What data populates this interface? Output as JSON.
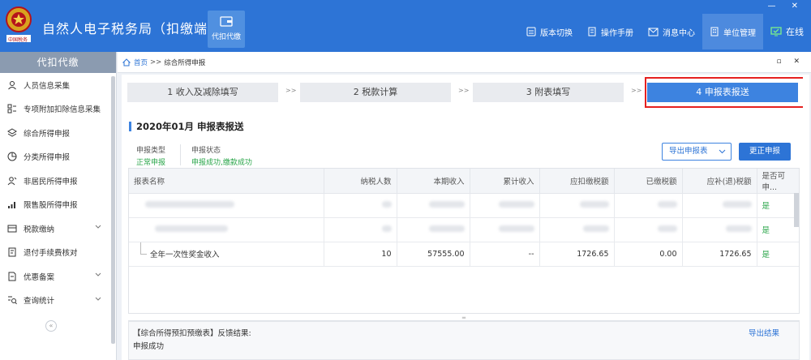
{
  "app": {
    "logo_text": "中国税务",
    "title": "自然人电子税务局（扣缴端）",
    "module_label": "代扣代缴",
    "window_controls": "— ✕"
  },
  "nav": [
    {
      "label": "版本切换",
      "icon": "switch-icon"
    },
    {
      "label": "操作手册",
      "icon": "manual-icon"
    },
    {
      "label": "消息中心",
      "icon": "message-icon"
    },
    {
      "label": "单位管理",
      "icon": "unit-icon"
    },
    {
      "label": "在线",
      "icon": "online-icon"
    }
  ],
  "sidebar": {
    "header": "代扣代缴",
    "items": [
      {
        "label": "人员信息采集",
        "icon": "person-icon",
        "expandable": false
      },
      {
        "label": "专项附加扣除信息采集",
        "icon": "grid-icon",
        "expandable": false
      },
      {
        "label": "综合所得申报",
        "icon": "layers-icon",
        "expandable": false
      },
      {
        "label": "分类所得申报",
        "icon": "pie-icon",
        "expandable": false
      },
      {
        "label": "非居民所得申报",
        "icon": "user-icon",
        "expandable": false
      },
      {
        "label": "限售股所得申报",
        "icon": "bars-icon",
        "expandable": false
      },
      {
        "label": "税款缴纳",
        "icon": "wallet-icon",
        "expandable": true
      },
      {
        "label": "退付手续费核对",
        "icon": "doc-icon",
        "expandable": false
      },
      {
        "label": "优惠备案",
        "icon": "file-icon",
        "expandable": true
      },
      {
        "label": "查询统计",
        "icon": "search-list-icon",
        "expandable": true
      }
    ],
    "collapse": "«"
  },
  "breadcrumb": {
    "home": "首页",
    "separator": ">>",
    "current": "综合所得申报",
    "controls": "▫ ✕"
  },
  "steps": [
    {
      "label": "1 收入及减除填写",
      "active": false
    },
    {
      "label": "2 税款计算",
      "active": false
    },
    {
      "label": "3 附表填写",
      "active": false
    },
    {
      "label": "4 申报表报送",
      "active": true
    }
  ],
  "step_arrow": ">>",
  "section": {
    "title": "2020年01月  申报表报送",
    "type_label": "申报类型",
    "type_value": "正常申报",
    "status_label": "申报状态",
    "status_value": "申报成功,缴款成功",
    "export_button": "导出申报表",
    "correct_button": "更正申报"
  },
  "table": {
    "headers": [
      "报表名称",
      "纳税人数",
      "本期收入",
      "累计收入",
      "应扣缴税额",
      "已缴税额",
      "应补(退)税额",
      "是否可申..."
    ],
    "rows": [
      {
        "blurred": true,
        "yes": "是"
      },
      {
        "blurred": true,
        "yes": "是"
      },
      {
        "blurred": false,
        "name": "全年一次性奖金收入",
        "count": "10",
        "income": "57555.00",
        "cumulative": "--",
        "payable": "1726.65",
        "paid": "0.00",
        "refund": "1726.65",
        "yes": "是"
      }
    ]
  },
  "splitter": "═",
  "result": {
    "title": "【综合所得预扣预缴表】反馈结果:",
    "text": "申报成功",
    "export": "导出结果"
  }
}
